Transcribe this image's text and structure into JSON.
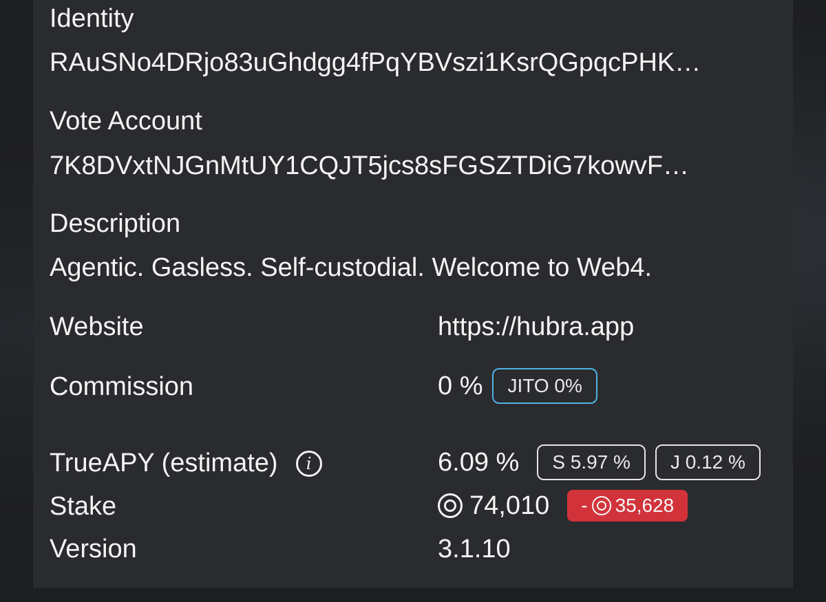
{
  "identity": {
    "label": "Identity",
    "value": "RAuSNo4DRjo83uGhdgg4fPqYBVszi1KsrQGpqcPHK…"
  },
  "vote_account": {
    "label": "Vote Account",
    "value": "7K8DVxtNJGnMtUY1CQJT5jcs8sFGSZTDiG7kowvF…"
  },
  "description": {
    "label": "Description",
    "value": "Agentic. Gasless. Self-custodial. Welcome to Web4."
  },
  "website": {
    "label": "Website",
    "value": "https://hubra.app"
  },
  "commission": {
    "label": "Commission",
    "value": "0 %",
    "badge": "JITO 0%"
  },
  "true_apy": {
    "label": "TrueAPY (estimate)",
    "info_icon": "info-icon",
    "info_glyph": "i",
    "value": "6.09 %",
    "badge_s": "S 5.97 %",
    "badge_j": "J 0.12 %"
  },
  "stake": {
    "label": "Stake",
    "icon": "sol-coin-icon",
    "value": "74,010",
    "change_prefix": "-",
    "change_value": "35,628"
  },
  "version": {
    "label": "Version",
    "value": "3.1.10"
  },
  "colors": {
    "jito_badge_border": "#4fb3e6",
    "stake_change_bg": "#d2333b",
    "panel_bg": "#2a2b2e"
  }
}
